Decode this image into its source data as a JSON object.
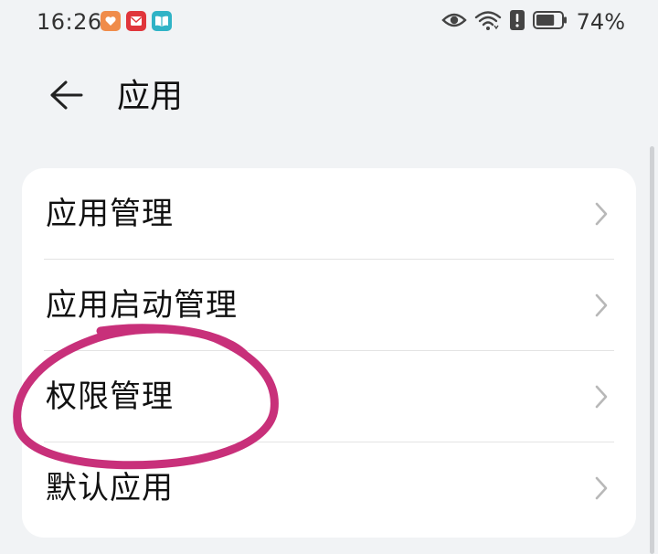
{
  "status_bar": {
    "time": "16:26",
    "battery_percent": "74%",
    "notification_icons": [
      "heart-app-icon",
      "mail-app-icon",
      "book-app-icon"
    ],
    "system_icons": [
      "eye-icon",
      "wifi-icon",
      "alert-icon",
      "battery-icon"
    ],
    "battery_level": 0.74
  },
  "header": {
    "back_icon": "arrow-left-icon",
    "title": "应用"
  },
  "settings_list": {
    "items": [
      {
        "label": "应用管理"
      },
      {
        "label": "应用启动管理"
      },
      {
        "label": "权限管理"
      },
      {
        "label": "默认应用"
      }
    ]
  },
  "annotation": {
    "color": "#c8307a",
    "target": "权限管理"
  },
  "colors": {
    "background": "#f1f3f5",
    "card": "#ffffff",
    "chevron": "#b8b8b8"
  }
}
